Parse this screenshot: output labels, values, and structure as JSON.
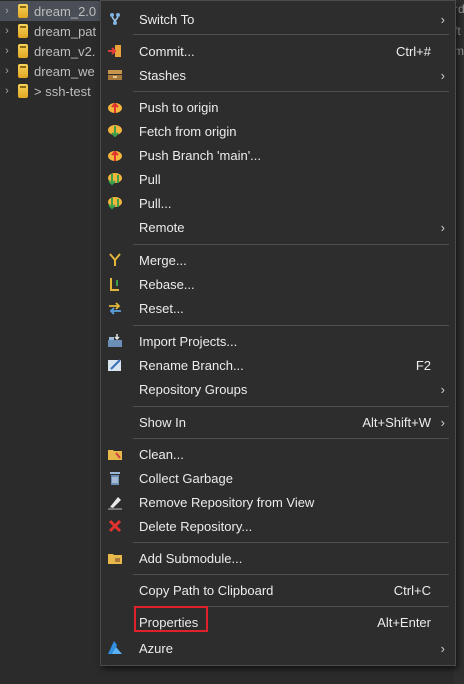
{
  "tree": {
    "rows": [
      {
        "label": "dream_2.0",
        "selected": true
      },
      {
        "label": "dream_pat"
      },
      {
        "label": "dream_v2."
      },
      {
        "label": "dream_we"
      },
      {
        "label": "> ssh-test"
      }
    ],
    "right_fragments": [
      "rd",
      "ft",
      "m"
    ]
  },
  "menu": {
    "switch_to": {
      "label": "Switch To",
      "icon": "switch-branch-icon"
    },
    "commit": {
      "label": "Commit...",
      "shortcut": "Ctrl+#",
      "icon": "commit-icon"
    },
    "stashes": {
      "label": "Stashes",
      "icon": "stashes-icon"
    },
    "push_origin": {
      "label": "Push to origin",
      "icon": "push-icon"
    },
    "fetch_origin": {
      "label": "Fetch from origin",
      "icon": "fetch-icon"
    },
    "push_branch": {
      "label": "Push Branch 'main'...",
      "icon": "push-branch-icon"
    },
    "pull": {
      "label": "Pull",
      "icon": "pull-icon"
    },
    "pull_dialog": {
      "label": "Pull...",
      "icon": "pull-dialog-icon"
    },
    "remote": {
      "label": "Remote"
    },
    "merge": {
      "label": "Merge...",
      "icon": "merge-icon"
    },
    "rebase": {
      "label": "Rebase...",
      "icon": "rebase-icon"
    },
    "reset": {
      "label": "Reset...",
      "icon": "reset-icon"
    },
    "import_projects": {
      "label": "Import Projects...",
      "icon": "import-icon"
    },
    "rename_branch": {
      "label": "Rename Branch...",
      "shortcut": "F2",
      "icon": "rename-icon"
    },
    "repo_groups": {
      "label": "Repository Groups"
    },
    "show_in": {
      "label": "Show In",
      "shortcut": "Alt+Shift+W"
    },
    "clean": {
      "label": "Clean...",
      "icon": "clean-icon"
    },
    "collect_garbage": {
      "label": "Collect Garbage",
      "icon": "trash-icon"
    },
    "remove_repo": {
      "label": "Remove Repository from View",
      "icon": "remove-icon"
    },
    "delete_repo": {
      "label": "Delete Repository...",
      "icon": "delete-icon"
    },
    "add_submodule": {
      "label": "Add Submodule...",
      "icon": "submodule-icon"
    },
    "copy_path": {
      "label": "Copy Path to Clipboard",
      "shortcut": "Ctrl+C"
    },
    "properties": {
      "label": "Properties",
      "shortcut": "Alt+Enter"
    },
    "azure": {
      "label": "Azure",
      "icon": "azure-icon"
    },
    "submenu_arrow": "›"
  },
  "colors": {
    "highlight_border": "#e0202a",
    "menu_bg": "#2d2d2d",
    "selected_row": "#4a4f57"
  }
}
